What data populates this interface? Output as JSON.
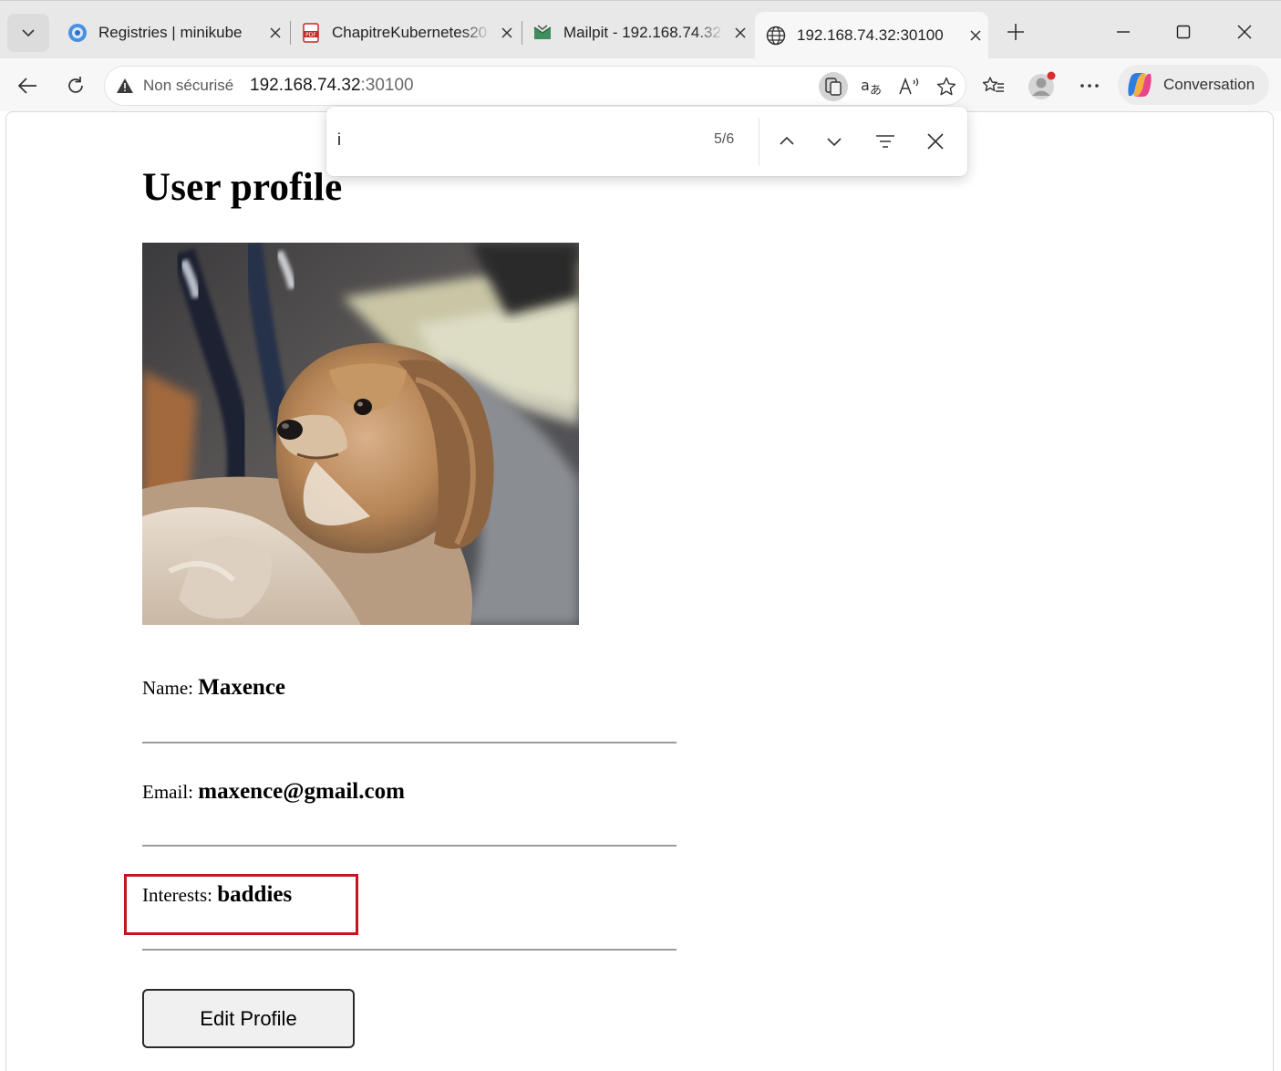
{
  "browser": {
    "tabs": [
      {
        "title": "Registries | minikube",
        "icon": "minikube-icon",
        "active": false
      },
      {
        "title": "ChapitreKubernetes20",
        "icon": "pdf-icon",
        "active": false
      },
      {
        "title": "Mailpit - 192.168.74.32",
        "icon": "mailpit-icon",
        "active": false
      },
      {
        "title": "192.168.74.32:30100",
        "icon": "globe-icon",
        "active": true
      }
    ],
    "address_bar": {
      "security_label": "Non sécurisé",
      "host": "192.168.74.32",
      "port": ":30100"
    },
    "copilot_label": "Conversation"
  },
  "find_bar": {
    "query": "i",
    "match_count": "5/6"
  },
  "profile": {
    "heading": "User profile",
    "photo_alt": "dog-photo",
    "fields": [
      {
        "label": "Name:",
        "value": "Maxence"
      },
      {
        "label": "Email:",
        "value": "maxence@gmail.com"
      },
      {
        "label": "Interests:",
        "value": "baddies"
      }
    ],
    "edit_button": "Edit Profile"
  },
  "colors": {
    "highlight_box": "#c3161c",
    "chrome_bg": "#e8e8e8",
    "toolbar_bg": "#f7f7f7"
  }
}
